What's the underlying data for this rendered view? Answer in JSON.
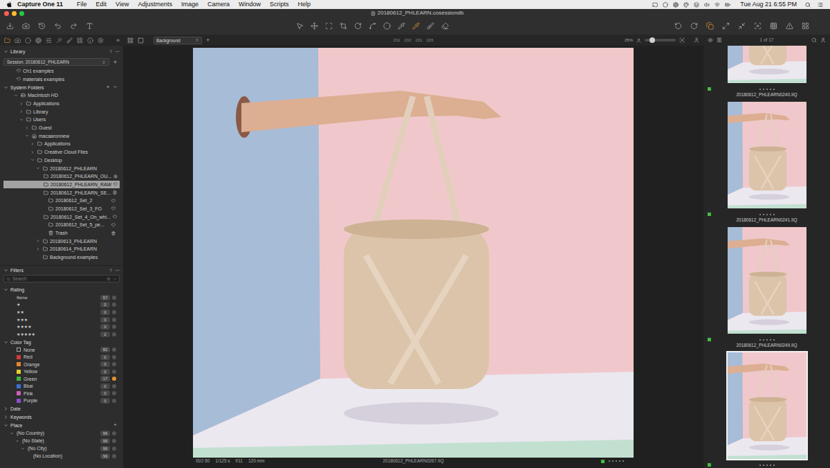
{
  "menubar": {
    "app": "Capture One 11",
    "menus": [
      "File",
      "Edit",
      "View",
      "Adjustments",
      "Image",
      "Camera",
      "Window",
      "Scripts",
      "Help"
    ],
    "clock": "Tue Aug 21  6:55 PM"
  },
  "window": {
    "title": "20180612_PHLEARN.cosessiondb"
  },
  "toolbar": {
    "tools": [
      {
        "selected": false
      },
      {
        "selected": false
      },
      {
        "selected": false
      },
      {
        "selected": false
      },
      {
        "selected": false
      },
      {
        "selected": false
      },
      {
        "selected": false
      },
      {
        "selected": false
      },
      {
        "selected": true
      },
      {
        "selected": false
      },
      {
        "selected": false
      }
    ]
  },
  "panel_tabs": {
    "tabs": [
      {
        "selected": true
      },
      {
        "selected": false
      },
      {
        "selected": false
      },
      {
        "selected": false
      },
      {
        "selected": false
      },
      {
        "selected": false
      },
      {
        "selected": false
      },
      {
        "selected": false
      },
      {
        "selected": false
      },
      {
        "selected": false
      }
    ],
    "more": "»"
  },
  "viewer_header": {
    "preset": "Background",
    "add": "+",
    "readout": [
      "231",
      "232",
      "231",
      "226"
    ],
    "zoom": "25%",
    "zoom_level": 0.25
  },
  "library": {
    "title": "Library",
    "help": "?",
    "session": "Session: 20180612_PHLEARN",
    "favorites": [
      "Ch1 examples",
      "materials examples"
    ],
    "system_folders": {
      "title": "System Folders",
      "add": "+",
      "remove": "−",
      "items": [
        {
          "label": "Macintosh HD",
          "depth": 0,
          "kind": "drive",
          "has_children": true,
          "expanded": true,
          "selected": false
        },
        {
          "label": "Applications",
          "depth": 1,
          "kind": "folder",
          "has_children": true,
          "expanded": false,
          "selected": false
        },
        {
          "label": "Library",
          "depth": 1,
          "kind": "folder",
          "has_children": true,
          "expanded": false,
          "selected": false
        },
        {
          "label": "Users",
          "depth": 1,
          "kind": "folder",
          "has_children": true,
          "expanded": true,
          "selected": false
        },
        {
          "label": "Guest",
          "depth": 2,
          "kind": "folder",
          "has_children": true,
          "expanded": false,
          "selected": false
        },
        {
          "label": "macaaronnew",
          "depth": 2,
          "kind": "home",
          "has_children": true,
          "expanded": true,
          "selected": false
        },
        {
          "label": "Applications",
          "depth": 3,
          "kind": "folder",
          "has_children": true,
          "expanded": false,
          "selected": false
        },
        {
          "label": "Creative Cloud Files",
          "depth": 3,
          "kind": "folder",
          "has_children": true,
          "expanded": false,
          "selected": false
        },
        {
          "label": "Desktop",
          "depth": 3,
          "kind": "folder",
          "has_children": true,
          "expanded": true,
          "selected": false
        },
        {
          "label": "20180612_PHLEARN",
          "depth": 4,
          "kind": "folder",
          "has_children": true,
          "expanded": true,
          "selected": false
        },
        {
          "label": "20180612_PHLEARN_OU...",
          "depth": 5,
          "kind": "output",
          "has_children": false,
          "expanded": false,
          "selected": false
        },
        {
          "label": "20180612_PHLEARN_RAW",
          "depth": 5,
          "kind": "folder",
          "has_children": false,
          "expanded": false,
          "selected": true
        },
        {
          "label": "20180612_PHLEARN_SE...",
          "depth": 5,
          "kind": "selects",
          "has_children": false,
          "expanded": false,
          "selected": false
        },
        {
          "label": "20180612_Set_2",
          "depth": 5,
          "kind": "folder",
          "has_children": false,
          "expanded": false,
          "selected": false
        },
        {
          "label": "20180612_Set_3_FO",
          "depth": 5,
          "kind": "folder",
          "has_children": false,
          "expanded": false,
          "selected": false
        },
        {
          "label": "20180612_Set_4_On_whi...",
          "depth": 5,
          "kind": "folder",
          "has_children": false,
          "expanded": false,
          "selected": false
        },
        {
          "label": "20180612_Set_5_pe...",
          "depth": 5,
          "kind": "folder",
          "has_children": false,
          "expanded": false,
          "selected": false
        },
        {
          "label": "Trash",
          "depth": 5,
          "kind": "trash",
          "has_children": false,
          "expanded": false,
          "selected": false
        },
        {
          "label": "20180613_PHLEARN",
          "depth": 4,
          "kind": "folder",
          "has_children": true,
          "expanded": false,
          "selected": false
        },
        {
          "label": "20180614_PHLEARN",
          "depth": 4,
          "kind": "folder",
          "has_children": true,
          "expanded": false,
          "selected": false
        },
        {
          "label": "Background examples",
          "depth": 4,
          "kind": "folder",
          "has_children": false,
          "expanded": false,
          "selected": false
        }
      ]
    }
  },
  "filters": {
    "title": "Filters",
    "help": "?",
    "search": {
      "placeholder": "Search"
    },
    "rating": {
      "title": "Rating",
      "expanded": true,
      "rows": [
        {
          "label": "None",
          "count": "57",
          "active": false
        },
        {
          "label": "★",
          "count": "0",
          "active": false
        },
        {
          "label": "★★",
          "count": "0",
          "active": false
        },
        {
          "label": "★★★",
          "count": "0",
          "active": false
        },
        {
          "label": "★★★★",
          "count": "0",
          "active": false
        },
        {
          "label": "★★★★★",
          "count": "2",
          "active": false
        }
      ]
    },
    "color_tag": {
      "title": "Color Tag",
      "expanded": true,
      "rows": [
        {
          "label": "None",
          "count": "82",
          "active": false,
          "color": null
        },
        {
          "label": "Red",
          "count": "0",
          "active": false,
          "color": "#d43a3a"
        },
        {
          "label": "Orange",
          "count": "0",
          "active": false,
          "color": "#e8862a"
        },
        {
          "label": "Yellow",
          "count": "0",
          "active": false,
          "color": "#e3cf2a"
        },
        {
          "label": "Green",
          "count": "17",
          "active": true,
          "color": "#3fb53f"
        },
        {
          "label": "Blue",
          "count": "0",
          "active": false,
          "color": "#3c6fd6"
        },
        {
          "label": "Pink",
          "count": "0",
          "active": false,
          "color": "#d15fb6"
        },
        {
          "label": "Purple",
          "count": "0",
          "active": false,
          "color": "#8b4fc9"
        }
      ]
    },
    "date": {
      "title": "Date",
      "expanded": false
    },
    "keywords": {
      "title": "Keywords",
      "expanded": false
    },
    "place": {
      "title": "Place",
      "expanded": true,
      "add": "+",
      "items": [
        {
          "label": "(No Country)",
          "count": "99",
          "depth": 0,
          "expanded": true
        },
        {
          "label": "(No State)",
          "count": "99",
          "depth": 1,
          "expanded": true
        },
        {
          "label": "(No City)",
          "count": "99",
          "depth": 2,
          "expanded": true
        },
        {
          "label": "(No Location)",
          "count": "99",
          "depth": 3,
          "expanded": false
        }
      ]
    }
  },
  "viewer": {
    "meta": [
      "ISO 50",
      "1/125 s",
      "f/11",
      "120 mm"
    ],
    "filename": "20180612_PHLEARN0267.IIQ",
    "stars": 0,
    "tag_color": "#3fbf3f"
  },
  "browser": {
    "counter": "1 of 17",
    "thumbnails": [
      {
        "name": "20180612_PHLEARN0240.IIQ",
        "stars": 0,
        "tag_color": "#3fbf3f",
        "selected": false
      },
      {
        "name": "20180612_PHLEARN0241.IIQ",
        "stars": 0,
        "tag_color": "#3fbf3f",
        "selected": false
      },
      {
        "name": "20180612_PHLEARN0249.IIQ",
        "stars": 0,
        "tag_color": "#3fbf3f",
        "selected": false
      },
      {
        "name": "",
        "stars": 0,
        "tag_color": "#3fbf3f",
        "selected": true
      }
    ]
  }
}
